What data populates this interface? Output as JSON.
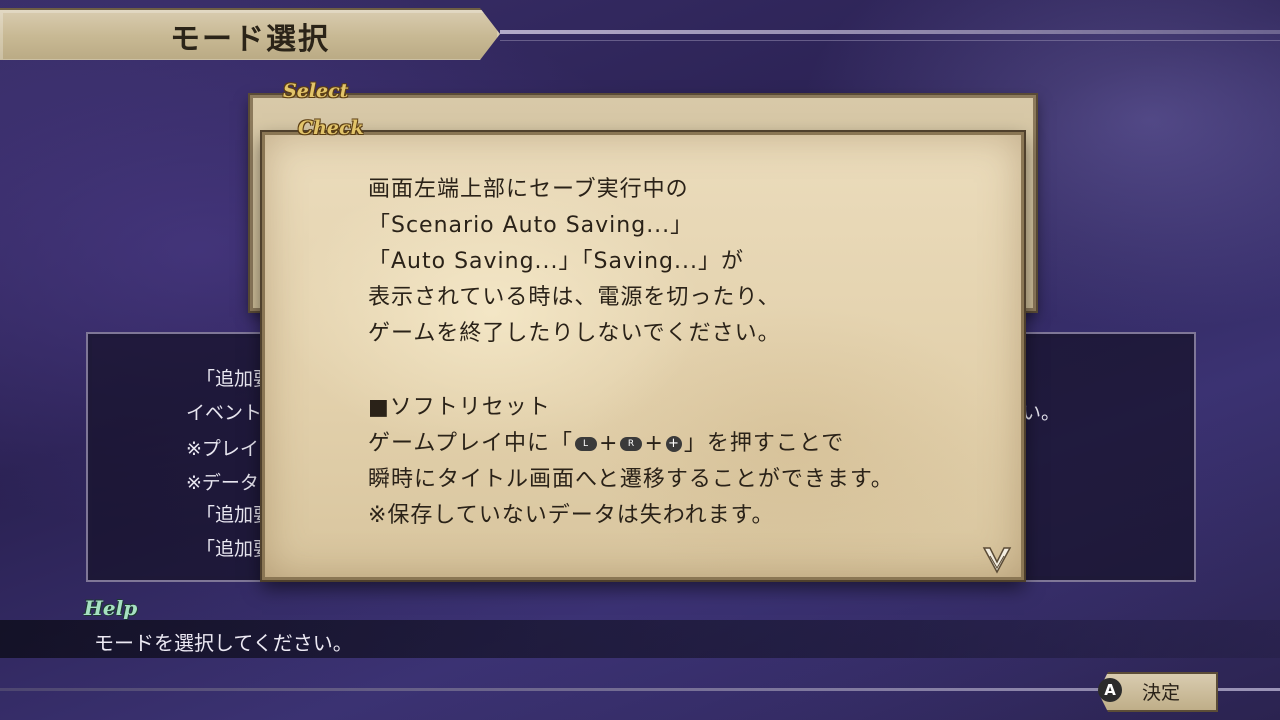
{
  "header": {
    "title": "モード選択"
  },
  "select_panel": {
    "label": "Select"
  },
  "info_panel": {
    "lines": [
      "「追加要",
      "イベント",
      "※プレイ",
      "※データ",
      "「追加要",
      "「追加要"
    ],
    "line_right": "い。"
  },
  "check_dialog": {
    "label": "Check",
    "message_lines": [
      "画面左端上部にセーブ実行中の",
      "「Scenario Auto Saving...」",
      "「Auto Saving...」「Saving...」が",
      "表示されている時は、電源を切ったり、",
      "ゲームを終了したりしないでください。"
    ],
    "soft_reset": {
      "heading": "■ソフトリセット",
      "line1_prefix": "ゲームプレイ中に「",
      "button_l": "L",
      "button_r": "R",
      "button_plus": "+",
      "plus_sign": "+",
      "line1_suffix": "」を押すことで",
      "line2": "瞬時にタイトル画面へと遷移することができます。",
      "line3": "※保存していないデータは失われます。"
    },
    "next_icon": "chevron-down-icon"
  },
  "help": {
    "label": "Help",
    "text": "モードを選択してください。"
  },
  "confirm": {
    "button_glyph": "A",
    "label": "決定"
  }
}
